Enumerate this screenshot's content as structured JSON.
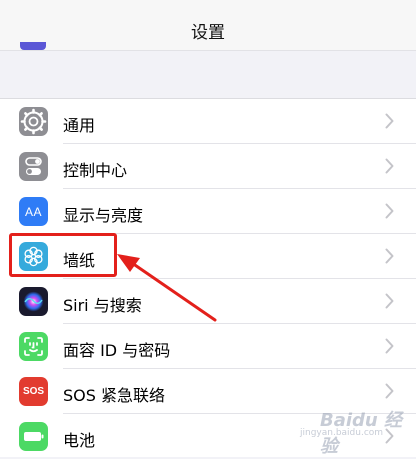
{
  "header": {
    "title": "设置"
  },
  "settings": {
    "items": [
      {
        "label": "通用",
        "icon": "gear-icon",
        "color": "#8e8e93"
      },
      {
        "label": "控制中心",
        "icon": "toggles-icon",
        "color": "#8e8e93"
      },
      {
        "label": "显示与亮度",
        "icon": "text-size-icon",
        "color": "#2f7cf6"
      },
      {
        "label": "墙纸",
        "icon": "flower-icon",
        "color": "#35aadc"
      },
      {
        "label": "Siri 与搜索",
        "icon": "siri-icon",
        "color": "#1a1a2e"
      },
      {
        "label": "面容 ID 与密码",
        "icon": "face-id-icon",
        "color": "#4cd964"
      },
      {
        "label": "SOS 紧急联络",
        "icon": "sos-icon",
        "color": "#e23b2f"
      },
      {
        "label": "电池",
        "icon": "battery-icon",
        "color": "#4cd964"
      }
    ],
    "display_icon_text": "AA",
    "sos_icon_text": "SOS"
  },
  "annotation": {
    "color": "#e3201b",
    "highlighted_item": "墙纸"
  },
  "watermark": {
    "text": "Baidu 经验",
    "sub": "jingyan.baidu.com"
  }
}
